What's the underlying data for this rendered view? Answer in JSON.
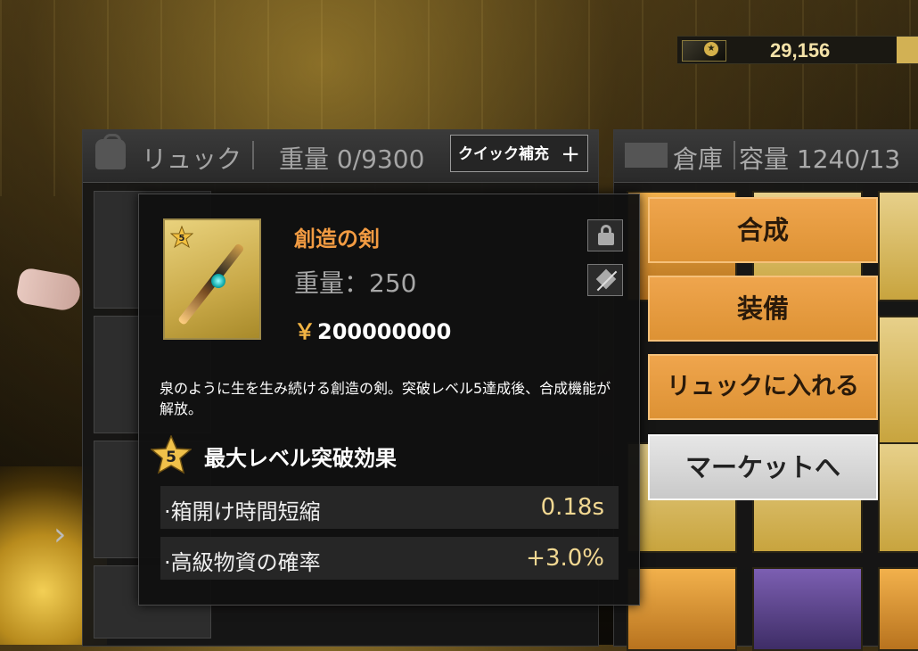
{
  "currency": {
    "amount": "29,156"
  },
  "backpack": {
    "title": "リュック",
    "weight_label": "重量 0/9300",
    "quick_refill_label": "クイック補充",
    "quick_refill_icon": "plus-icon"
  },
  "storage": {
    "title": "倉庫",
    "capacity_label": "容量 1240/13"
  },
  "item": {
    "name": "創造の剣",
    "rarity": "5",
    "weight": "重量：250",
    "price_symbol": "￥",
    "price": "200000000",
    "description": "泉のように生を生み続ける創造の剣。突破レベル5達成後、合成機能が解放。",
    "max_level_badge": "5",
    "max_level_title": "最大レベル突破効果",
    "effects": [
      {
        "label": "·箱開け時間短縮",
        "value": "0.18s"
      },
      {
        "label": "·高級物資の確率",
        "value": "+3.0%"
      }
    ]
  },
  "actions": {
    "craft": "合成",
    "equip": "装備",
    "to_backpack": "リュックに入れる",
    "to_market": "マーケットへ"
  },
  "colors": {
    "accent_orange": "#efa54d",
    "item_name": "#f29b42",
    "gold": "#d4b04a"
  }
}
